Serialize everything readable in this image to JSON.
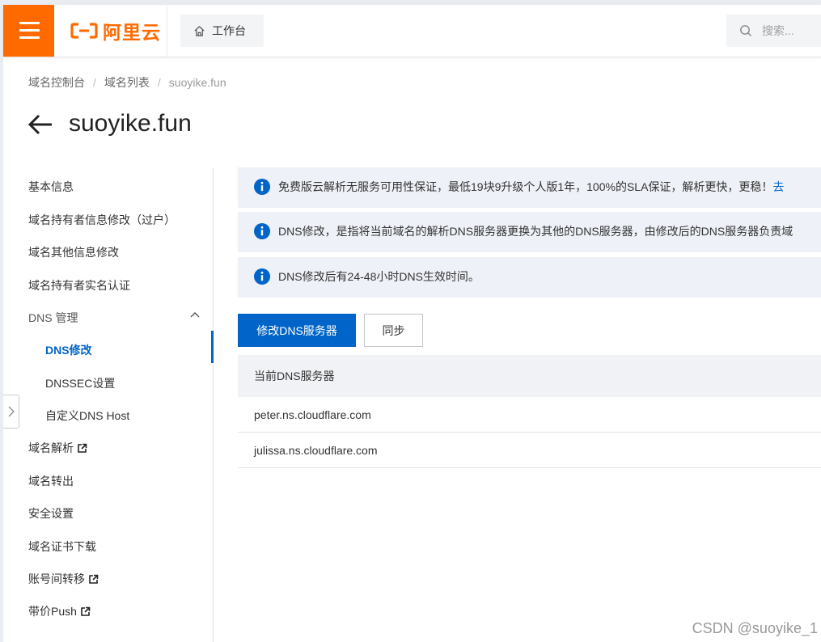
{
  "header": {
    "logo_text": "阿里云",
    "workbench_label": "工作台",
    "search_placeholder": "搜索..."
  },
  "breadcrumb": [
    "域名控制台",
    "域名列表",
    "suoyike.fun"
  ],
  "page_title": "suoyike.fun",
  "sidebar": {
    "items": [
      {
        "label": "基本信息"
      },
      {
        "label": "域名持有者信息修改（过户）"
      },
      {
        "label": "域名其他信息修改"
      },
      {
        "label": "域名持有者实名认证"
      },
      {
        "label": "DNS 管理"
      },
      {
        "label": "DNS修改"
      },
      {
        "label": "DNSSEC设置"
      },
      {
        "label": "自定义DNS Host"
      },
      {
        "label": "域名解析"
      },
      {
        "label": "域名转出"
      },
      {
        "label": "安全设置"
      },
      {
        "label": "域名证书下载"
      },
      {
        "label": "账号间转移"
      },
      {
        "label": "带价Push"
      }
    ]
  },
  "notices": [
    {
      "text": "免费版云解析无服务可用性保证，最低19块9升级个人版1年，100%的SLA保证，解析更快，更稳！",
      "link": "去"
    },
    {
      "text": "DNS修改，是指将当前域名的解析DNS服务器更换为其他的DNS服务器，由修改后的DNS服务器负责域"
    },
    {
      "text": "DNS修改后有24-48小时DNS生效时间。"
    }
  ],
  "actions": {
    "modify_dns_label": "修改DNS服务器",
    "sync_label": "同步"
  },
  "table": {
    "header": "当前DNS服务器",
    "rows": [
      "peter.ns.cloudflare.com",
      "julissa.ns.cloudflare.com"
    ]
  },
  "watermark": "CSDN @suoyike_1",
  "colors": {
    "brand_orange": "#ff6a00",
    "primary_blue": "#0064c8",
    "notice_bg": "#eef1f7"
  }
}
